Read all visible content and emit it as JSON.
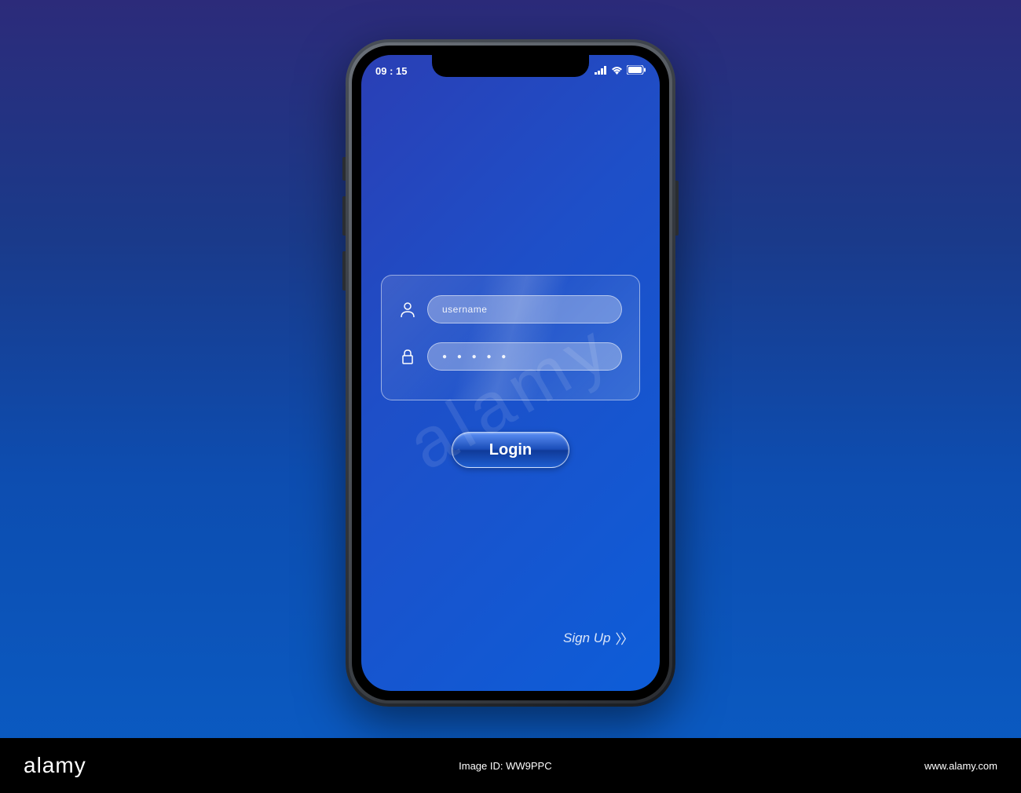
{
  "status_bar": {
    "time": "09 : 15"
  },
  "login_form": {
    "username_placeholder": "username",
    "password_dots": "● ● ● ● ●"
  },
  "buttons": {
    "login_label": "Login",
    "signup_label": "Sign Up"
  },
  "footer": {
    "brand": "alamy",
    "image_id": "Image ID: WW9PPC",
    "site": "www.alamy.com"
  },
  "watermark": "alamy"
}
